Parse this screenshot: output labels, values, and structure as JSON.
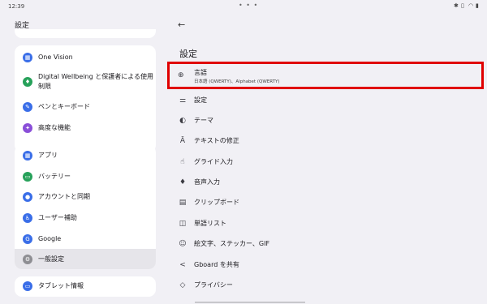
{
  "status": {
    "time": "12:39"
  },
  "left": {
    "title": "設定",
    "group1": [
      {
        "label": "One Vision",
        "icon": "one-vision-icon",
        "color": "#3a6ee8"
      },
      {
        "label": "Digital Wellbeing と保護者による使用",
        "label2": "制限",
        "icon": "wellbeing-icon",
        "color": "#27a15a"
      },
      {
        "label": "ペンとキーボード",
        "icon": "pen-icon",
        "color": "#3a6ee8"
      },
      {
        "label": "高度な機能",
        "icon": "advanced-icon",
        "color": "#8a4fd8"
      }
    ],
    "group2": [
      {
        "label": "アプリ",
        "icon": "apps-icon",
        "color": "#3a6ee8"
      },
      {
        "label": "バッテリー",
        "icon": "battery-icon",
        "color": "#27a15a"
      },
      {
        "label": "アカウントと同期",
        "icon": "account-icon",
        "color": "#3a6ee8"
      },
      {
        "label": "ユーザー補助",
        "icon": "accessibility-icon",
        "color": "#3a6ee8"
      },
      {
        "label": "Google",
        "icon": "google-icon",
        "color": "#3a6ee8"
      },
      {
        "label": "一般設定",
        "icon": "general-settings-icon",
        "color": "#8e8e93"
      }
    ],
    "group3": [
      {
        "label": "タブレット情報",
        "icon": "tablet-info-icon",
        "color": "#3a6ee8"
      }
    ]
  },
  "right": {
    "title": "設定",
    "language": {
      "label": "言語",
      "sublabel": "日本語 (QWERTY)、Alphabet (QWERTY)"
    },
    "items": [
      {
        "label": "設定",
        "icon": "sliders-icon",
        "glyph": "⚌"
      },
      {
        "label": "テーマ",
        "icon": "palette-icon",
        "glyph": "◐"
      },
      {
        "label": "テキストの修正",
        "icon": "text-correction-icon",
        "glyph": "Ā"
      },
      {
        "label": "グライド入力",
        "icon": "glide-typing-icon",
        "glyph": "☝"
      },
      {
        "label": "音声入力",
        "icon": "mic-icon",
        "glyph": "♦"
      },
      {
        "label": "クリップボード",
        "icon": "clipboard-icon",
        "glyph": "▤"
      },
      {
        "label": "単語リスト",
        "icon": "dictionary-icon",
        "glyph": "◫"
      },
      {
        "label": "絵文字、ステッカー、GIF",
        "icon": "emoji-icon",
        "glyph": "☺"
      },
      {
        "label": "Gboard を共有",
        "icon": "share-icon",
        "glyph": "<"
      },
      {
        "label": "プライバシー",
        "icon": "privacy-icon",
        "glyph": "◇"
      }
    ]
  }
}
